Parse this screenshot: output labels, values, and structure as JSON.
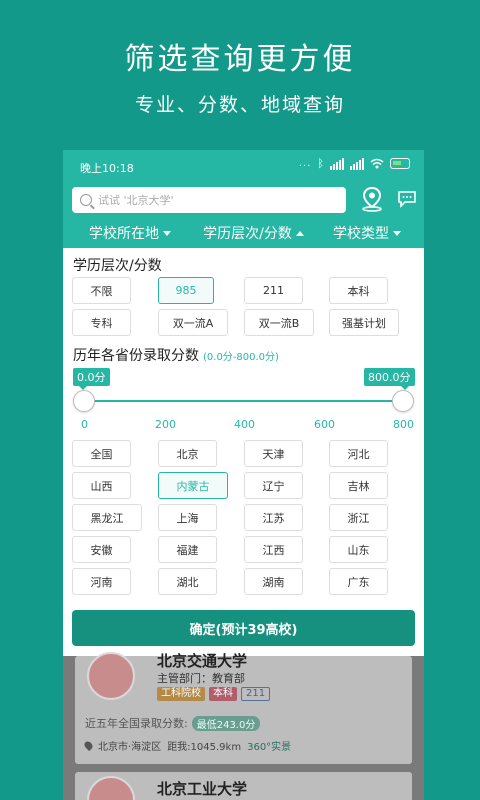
{
  "promo": {
    "title": "筛选查询更方便",
    "subtitle": "专业、分数、地域查询"
  },
  "status_bar": {
    "time": "晚上10:18",
    "dots": "...",
    "bluetooth": "ᛒ"
  },
  "search": {
    "placeholder": "试试 '北京大学'"
  },
  "header_icons": [
    "location-pin-icon",
    "message-icon"
  ],
  "filters": [
    {
      "label": "学校所在地",
      "state": "collapsed"
    },
    {
      "label": "学历层次/分数",
      "state": "expanded"
    },
    {
      "label": "学校类型",
      "state": "collapsed"
    }
  ],
  "level_section": {
    "title": "学历层次/分数",
    "options": [
      "不限",
      "985",
      "211",
      "本科",
      "专科",
      "双一流A",
      "双一流B",
      "强基计划"
    ],
    "selected": "985"
  },
  "score_section": {
    "title": "历年各省份录取分数",
    "range_text": "(0.0分-800.0分)",
    "min_label": "0.0分",
    "max_label": "800.0分",
    "min_value": 0,
    "max_value": 800,
    "ticks": [
      "0",
      "200",
      "400",
      "600",
      "800"
    ]
  },
  "provinces": {
    "options": [
      "全国",
      "北京",
      "天津",
      "河北",
      "山西",
      "内蒙古",
      "辽宁",
      "吉林",
      "黑龙江",
      "上海",
      "江苏",
      "浙江",
      "安徽",
      "福建",
      "江西",
      "山东",
      "河南",
      "湖北",
      "湖南",
      "广东"
    ],
    "selected": "内蒙古"
  },
  "confirm": {
    "label": "确定(预计39高校)"
  },
  "result_cards": [
    {
      "name": "北京交通大学",
      "dept": "主管部门：教育部",
      "tags": [
        "工科院校",
        "本科",
        "211"
      ],
      "score_label": "近五年全国录取分数:",
      "score_badge": "最低243.0分",
      "address": "北京市·海淀区",
      "distance": "距我:1045.9km",
      "vr": "360°实景"
    },
    {
      "name": "北京工业大学"
    }
  ],
  "colors": {
    "primary": "#26b7a4",
    "background": "#13998a",
    "confirm": "#16907f"
  }
}
